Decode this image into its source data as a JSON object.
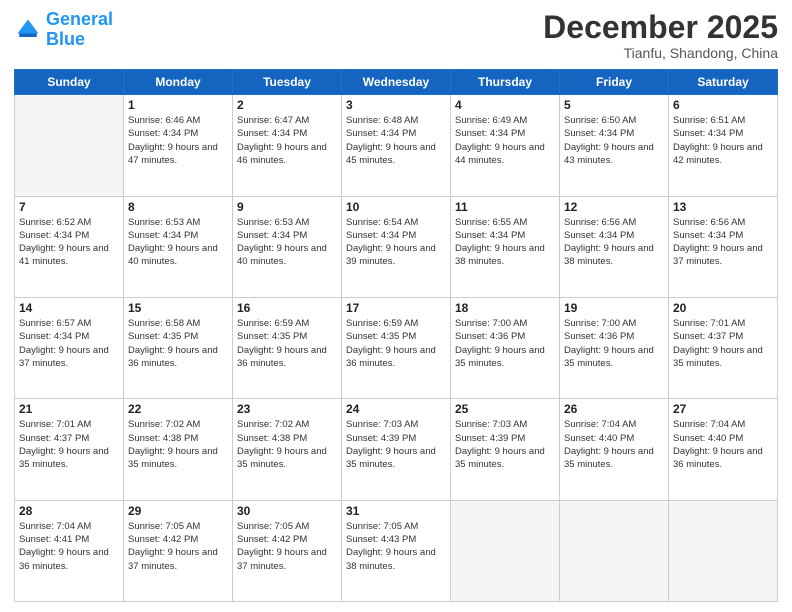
{
  "header": {
    "logo_general": "General",
    "logo_blue": "Blue",
    "title": "December 2025",
    "subtitle": "Tianfu, Shandong, China"
  },
  "weekdays": [
    "Sunday",
    "Monday",
    "Tuesday",
    "Wednesday",
    "Thursday",
    "Friday",
    "Saturday"
  ],
  "weeks": [
    [
      {
        "day": "",
        "sunrise": "",
        "sunset": "",
        "daylight": ""
      },
      {
        "day": "1",
        "sunrise": "Sunrise: 6:46 AM",
        "sunset": "Sunset: 4:34 PM",
        "daylight": "Daylight: 9 hours and 47 minutes."
      },
      {
        "day": "2",
        "sunrise": "Sunrise: 6:47 AM",
        "sunset": "Sunset: 4:34 PM",
        "daylight": "Daylight: 9 hours and 46 minutes."
      },
      {
        "day": "3",
        "sunrise": "Sunrise: 6:48 AM",
        "sunset": "Sunset: 4:34 PM",
        "daylight": "Daylight: 9 hours and 45 minutes."
      },
      {
        "day": "4",
        "sunrise": "Sunrise: 6:49 AM",
        "sunset": "Sunset: 4:34 PM",
        "daylight": "Daylight: 9 hours and 44 minutes."
      },
      {
        "day": "5",
        "sunrise": "Sunrise: 6:50 AM",
        "sunset": "Sunset: 4:34 PM",
        "daylight": "Daylight: 9 hours and 43 minutes."
      },
      {
        "day": "6",
        "sunrise": "Sunrise: 6:51 AM",
        "sunset": "Sunset: 4:34 PM",
        "daylight": "Daylight: 9 hours and 42 minutes."
      }
    ],
    [
      {
        "day": "7",
        "sunrise": "Sunrise: 6:52 AM",
        "sunset": "Sunset: 4:34 PM",
        "daylight": "Daylight: 9 hours and 41 minutes."
      },
      {
        "day": "8",
        "sunrise": "Sunrise: 6:53 AM",
        "sunset": "Sunset: 4:34 PM",
        "daylight": "Daylight: 9 hours and 40 minutes."
      },
      {
        "day": "9",
        "sunrise": "Sunrise: 6:53 AM",
        "sunset": "Sunset: 4:34 PM",
        "daylight": "Daylight: 9 hours and 40 minutes."
      },
      {
        "day": "10",
        "sunrise": "Sunrise: 6:54 AM",
        "sunset": "Sunset: 4:34 PM",
        "daylight": "Daylight: 9 hours and 39 minutes."
      },
      {
        "day": "11",
        "sunrise": "Sunrise: 6:55 AM",
        "sunset": "Sunset: 4:34 PM",
        "daylight": "Daylight: 9 hours and 38 minutes."
      },
      {
        "day": "12",
        "sunrise": "Sunrise: 6:56 AM",
        "sunset": "Sunset: 4:34 PM",
        "daylight": "Daylight: 9 hours and 38 minutes."
      },
      {
        "day": "13",
        "sunrise": "Sunrise: 6:56 AM",
        "sunset": "Sunset: 4:34 PM",
        "daylight": "Daylight: 9 hours and 37 minutes."
      }
    ],
    [
      {
        "day": "14",
        "sunrise": "Sunrise: 6:57 AM",
        "sunset": "Sunset: 4:34 PM",
        "daylight": "Daylight: 9 hours and 37 minutes."
      },
      {
        "day": "15",
        "sunrise": "Sunrise: 6:58 AM",
        "sunset": "Sunset: 4:35 PM",
        "daylight": "Daylight: 9 hours and 36 minutes."
      },
      {
        "day": "16",
        "sunrise": "Sunrise: 6:59 AM",
        "sunset": "Sunset: 4:35 PM",
        "daylight": "Daylight: 9 hours and 36 minutes."
      },
      {
        "day": "17",
        "sunrise": "Sunrise: 6:59 AM",
        "sunset": "Sunset: 4:35 PM",
        "daylight": "Daylight: 9 hours and 36 minutes."
      },
      {
        "day": "18",
        "sunrise": "Sunrise: 7:00 AM",
        "sunset": "Sunset: 4:36 PM",
        "daylight": "Daylight: 9 hours and 35 minutes."
      },
      {
        "day": "19",
        "sunrise": "Sunrise: 7:00 AM",
        "sunset": "Sunset: 4:36 PM",
        "daylight": "Daylight: 9 hours and 35 minutes."
      },
      {
        "day": "20",
        "sunrise": "Sunrise: 7:01 AM",
        "sunset": "Sunset: 4:37 PM",
        "daylight": "Daylight: 9 hours and 35 minutes."
      }
    ],
    [
      {
        "day": "21",
        "sunrise": "Sunrise: 7:01 AM",
        "sunset": "Sunset: 4:37 PM",
        "daylight": "Daylight: 9 hours and 35 minutes."
      },
      {
        "day": "22",
        "sunrise": "Sunrise: 7:02 AM",
        "sunset": "Sunset: 4:38 PM",
        "daylight": "Daylight: 9 hours and 35 minutes."
      },
      {
        "day": "23",
        "sunrise": "Sunrise: 7:02 AM",
        "sunset": "Sunset: 4:38 PM",
        "daylight": "Daylight: 9 hours and 35 minutes."
      },
      {
        "day": "24",
        "sunrise": "Sunrise: 7:03 AM",
        "sunset": "Sunset: 4:39 PM",
        "daylight": "Daylight: 9 hours and 35 minutes."
      },
      {
        "day": "25",
        "sunrise": "Sunrise: 7:03 AM",
        "sunset": "Sunset: 4:39 PM",
        "daylight": "Daylight: 9 hours and 35 minutes."
      },
      {
        "day": "26",
        "sunrise": "Sunrise: 7:04 AM",
        "sunset": "Sunset: 4:40 PM",
        "daylight": "Daylight: 9 hours and 35 minutes."
      },
      {
        "day": "27",
        "sunrise": "Sunrise: 7:04 AM",
        "sunset": "Sunset: 4:40 PM",
        "daylight": "Daylight: 9 hours and 36 minutes."
      }
    ],
    [
      {
        "day": "28",
        "sunrise": "Sunrise: 7:04 AM",
        "sunset": "Sunset: 4:41 PM",
        "daylight": "Daylight: 9 hours and 36 minutes."
      },
      {
        "day": "29",
        "sunrise": "Sunrise: 7:05 AM",
        "sunset": "Sunset: 4:42 PM",
        "daylight": "Daylight: 9 hours and 37 minutes."
      },
      {
        "day": "30",
        "sunrise": "Sunrise: 7:05 AM",
        "sunset": "Sunset: 4:42 PM",
        "daylight": "Daylight: 9 hours and 37 minutes."
      },
      {
        "day": "31",
        "sunrise": "Sunrise: 7:05 AM",
        "sunset": "Sunset: 4:43 PM",
        "daylight": "Daylight: 9 hours and 38 minutes."
      },
      {
        "day": "",
        "sunrise": "",
        "sunset": "",
        "daylight": ""
      },
      {
        "day": "",
        "sunrise": "",
        "sunset": "",
        "daylight": ""
      },
      {
        "day": "",
        "sunrise": "",
        "sunset": "",
        "daylight": ""
      }
    ]
  ]
}
